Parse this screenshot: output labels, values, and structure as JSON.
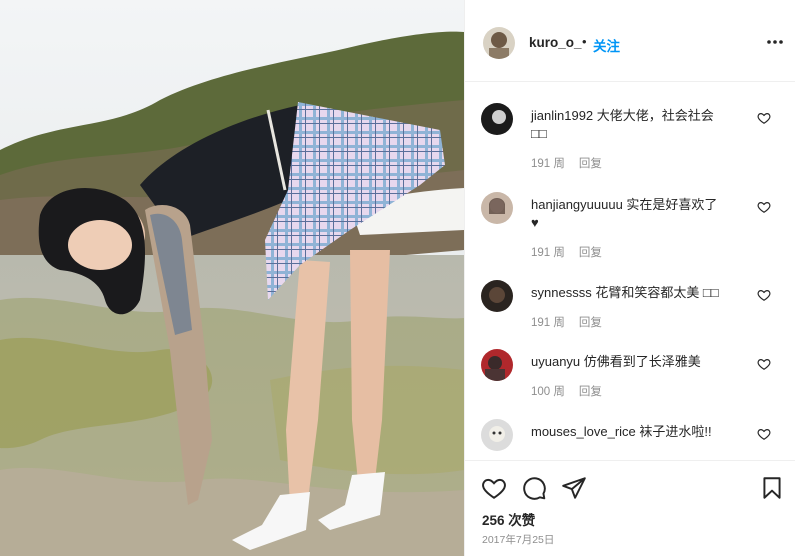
{
  "post": {
    "username": "kuro_o_",
    "separator": "•",
    "follow_label": "关注",
    "likes": "256 次赞",
    "date": "2017年7月25日"
  },
  "comments": [
    {
      "user": "jianlin1992",
      "text": " 大佬大佬，社会社会",
      "extra": "□□",
      "time": "191 周",
      "reply": "回复"
    },
    {
      "user": "hanjiangyuuuuu",
      "text": " 实在是好喜欢了",
      "extra": "♥",
      "time": "191 周",
      "reply": "回复"
    },
    {
      "user": "synnessss",
      "text": " 花臂和笑容都太美 □□",
      "extra": "",
      "time": "191 周",
      "reply": "回复"
    },
    {
      "user": "uyuanyu",
      "text": " 仿佛看到了长泽雅美",
      "extra": "",
      "time": "100 周",
      "reply": "回复"
    },
    {
      "user": "mouses_love_rice",
      "text": " 袜子进水啦!!",
      "extra": "",
      "time": "",
      "reply": ""
    }
  ],
  "icons": {
    "more": "more-icon",
    "like": "heart-icon",
    "comment": "comment-icon",
    "share": "share-icon",
    "save": "bookmark-icon"
  },
  "colors": {
    "follow": "#0095f6",
    "meta": "#8e8e8e",
    "text": "#262626",
    "border": "#efefef"
  }
}
